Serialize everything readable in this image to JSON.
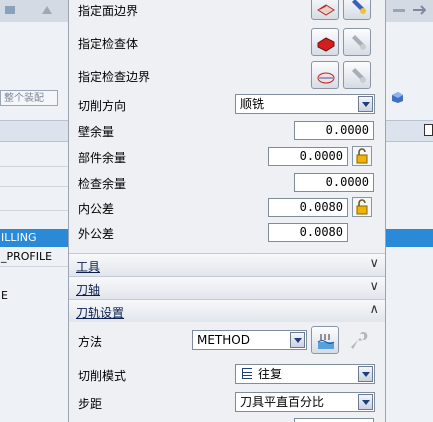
{
  "background": {
    "combo_text": "整个装配",
    "tree_rows": [
      "ILLING",
      "_PROFILE",
      "E"
    ]
  },
  "dialog": {
    "fields": {
      "part_boundary_label": "指定面边界",
      "check_body_label": "指定检查体",
      "check_boundary_label": "指定检查边界",
      "cut_direction_label": "切削方向",
      "cut_direction_value": "顺铣",
      "wall_stock_label": "壁余量",
      "wall_stock_value": "0.0000",
      "part_stock_label": "部件余量",
      "part_stock_value": "0.0000",
      "check_stock_label": "检查余量",
      "check_stock_value": "0.0000",
      "inner_tol_label": "内公差",
      "inner_tol_value": "0.0080",
      "outer_tol_label": "外公差",
      "outer_tol_value": "0.0080"
    },
    "sections": {
      "tool": "工具",
      "axis": "刀轴",
      "path_settings": "刀轨设置"
    },
    "path": {
      "method_label": "方法",
      "method_value": "METHOD",
      "cut_pattern_label": "切削模式",
      "cut_pattern_value": "往复",
      "stepover_label": "步距",
      "stepover_value": "刀具平直百分比"
    }
  },
  "colors": {
    "selection": "#2a8ad8",
    "dialog_bg": "#eef0f3",
    "section_title": "#0b1f4f"
  }
}
